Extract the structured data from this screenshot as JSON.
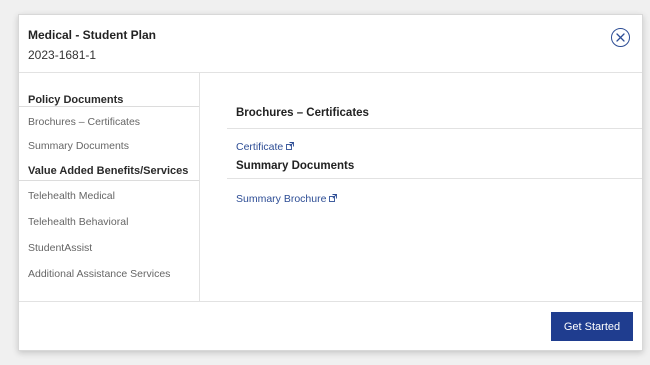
{
  "modal": {
    "title": "Medical - Student Plan",
    "plan_id": "2023-1681-1"
  },
  "sidebar": {
    "sections": [
      {
        "heading": "Policy Documents",
        "items": [
          "Brochures – Certificates",
          "Summary Documents"
        ]
      },
      {
        "heading": "Value Added Benefits/Services",
        "items": [
          "Telehealth Medical",
          "Telehealth Behavioral",
          "StudentAssist",
          "Additional Assistance Services"
        ]
      }
    ]
  },
  "content": {
    "sections": [
      {
        "heading": "Brochures – Certificates",
        "link": "Certificate"
      },
      {
        "heading": "Summary Documents",
        "link": "Summary Brochure"
      }
    ]
  },
  "footer": {
    "primary_label": "Get Started"
  },
  "colors": {
    "accent": "#1f3d8f",
    "link": "#2d4d95"
  },
  "icons": {
    "close": "close-circle-icon",
    "external": "external-link-icon"
  }
}
